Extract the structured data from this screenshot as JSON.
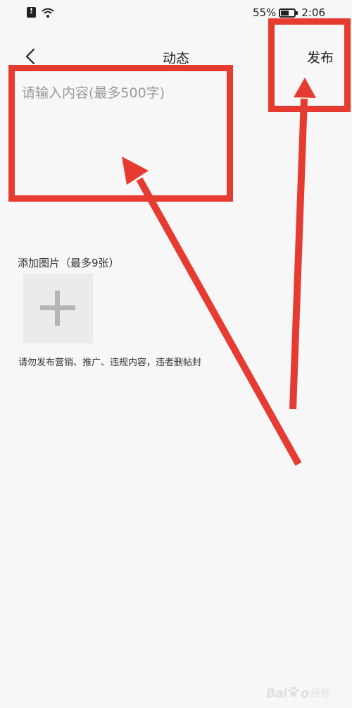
{
  "status_bar": {
    "battery_percent": "55%",
    "time": "2:06"
  },
  "header": {
    "title": "动态",
    "publish_label": "发布"
  },
  "content": {
    "placeholder": "请输入内容(最多500字)"
  },
  "images": {
    "label": "添加图片（最多9张）"
  },
  "notice": "请勿发布营销、推广、违规内容，违者删帖封",
  "watermark": {
    "latin": "Bai",
    "latin_suffix": "o",
    "cn": "经验"
  },
  "colors": {
    "annotation_red": "#e63b30",
    "background": "#f7f7f7",
    "image_button": "#ebebeb"
  },
  "icons": [
    "sim-alert-icon",
    "wifi-icon",
    "battery-icon",
    "back-chevron-icon",
    "plus-icon",
    "paw-icon"
  ]
}
